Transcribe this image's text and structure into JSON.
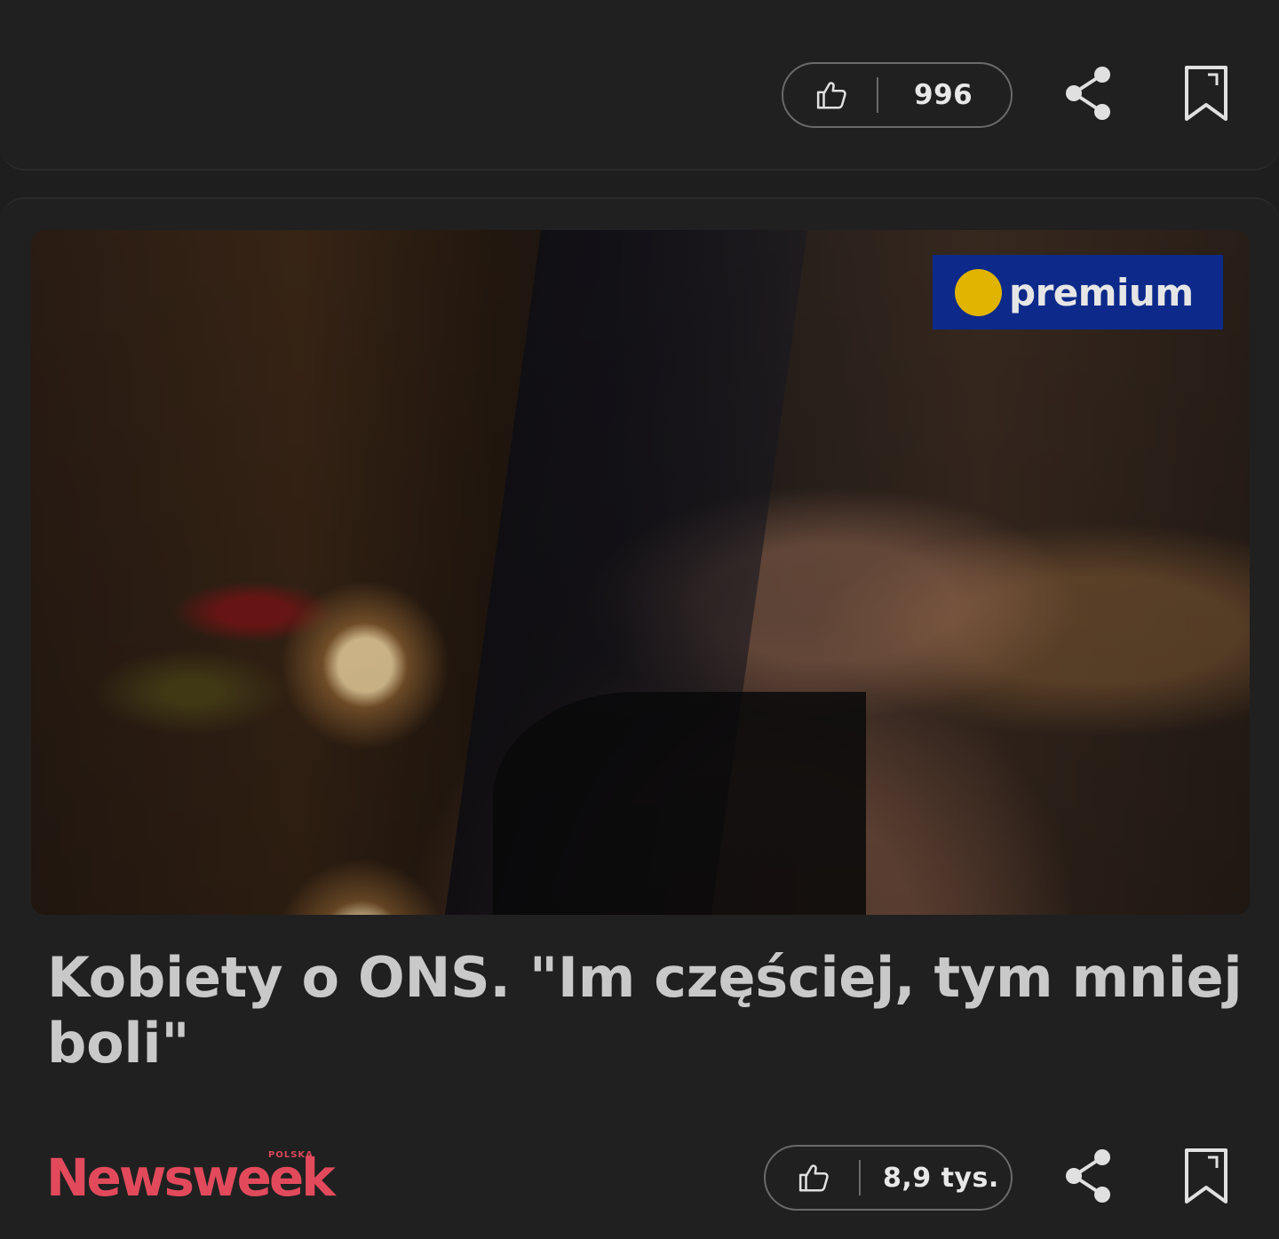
{
  "top_card": {
    "like_count": "996",
    "icons": {
      "like": "thumbs-up-icon",
      "share": "share-icon",
      "bookmark": "bookmark-icon"
    }
  },
  "article": {
    "badge": "premium",
    "title": "Kobiety o ONS. \"Im częściej, tym mniej boli\"",
    "source_name": "Newsweek",
    "source_sub": "POLSKA",
    "like_count": "8,9 tys."
  },
  "colors": {
    "background": "#1e1e1e",
    "card": "#202020",
    "badge_bg": "#0d2a8a",
    "badge_dot": "#e0b400",
    "brand": "#e24a5c"
  }
}
